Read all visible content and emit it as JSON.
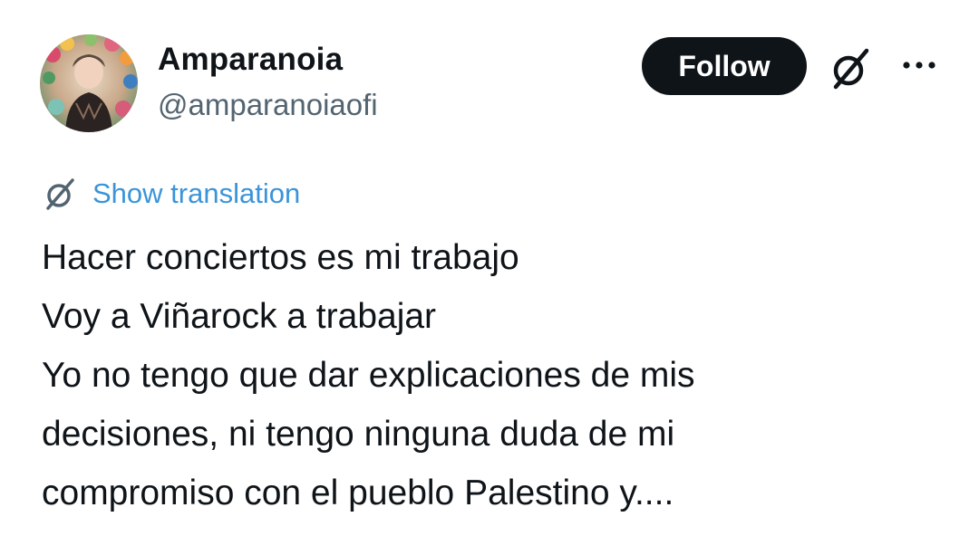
{
  "author": {
    "display_name": "Amparanoia",
    "handle": "@amparanoiaofi",
    "avatar_icon": "profile-photo"
  },
  "actions": {
    "follow_label": "Follow",
    "grok_icon": "grok-icon",
    "more_icon": "more-dots-icon"
  },
  "translation": {
    "icon": "translate-icon",
    "label": "Show translation"
  },
  "tweet": {
    "lines": [
      "Hacer conciertos es mi trabajo",
      "Voy a Viñarock a trabajar",
      "Yo no tengo que dar explicaciones de mis",
      "decisiones, ni tengo ninguna duda de mi",
      "compromiso con el pueblo Palestino y...."
    ]
  },
  "colors": {
    "text": "#0f1419",
    "secondary": "#536471",
    "link": "#3b94d9",
    "button_bg": "#0f1419",
    "button_text": "#ffffff"
  }
}
